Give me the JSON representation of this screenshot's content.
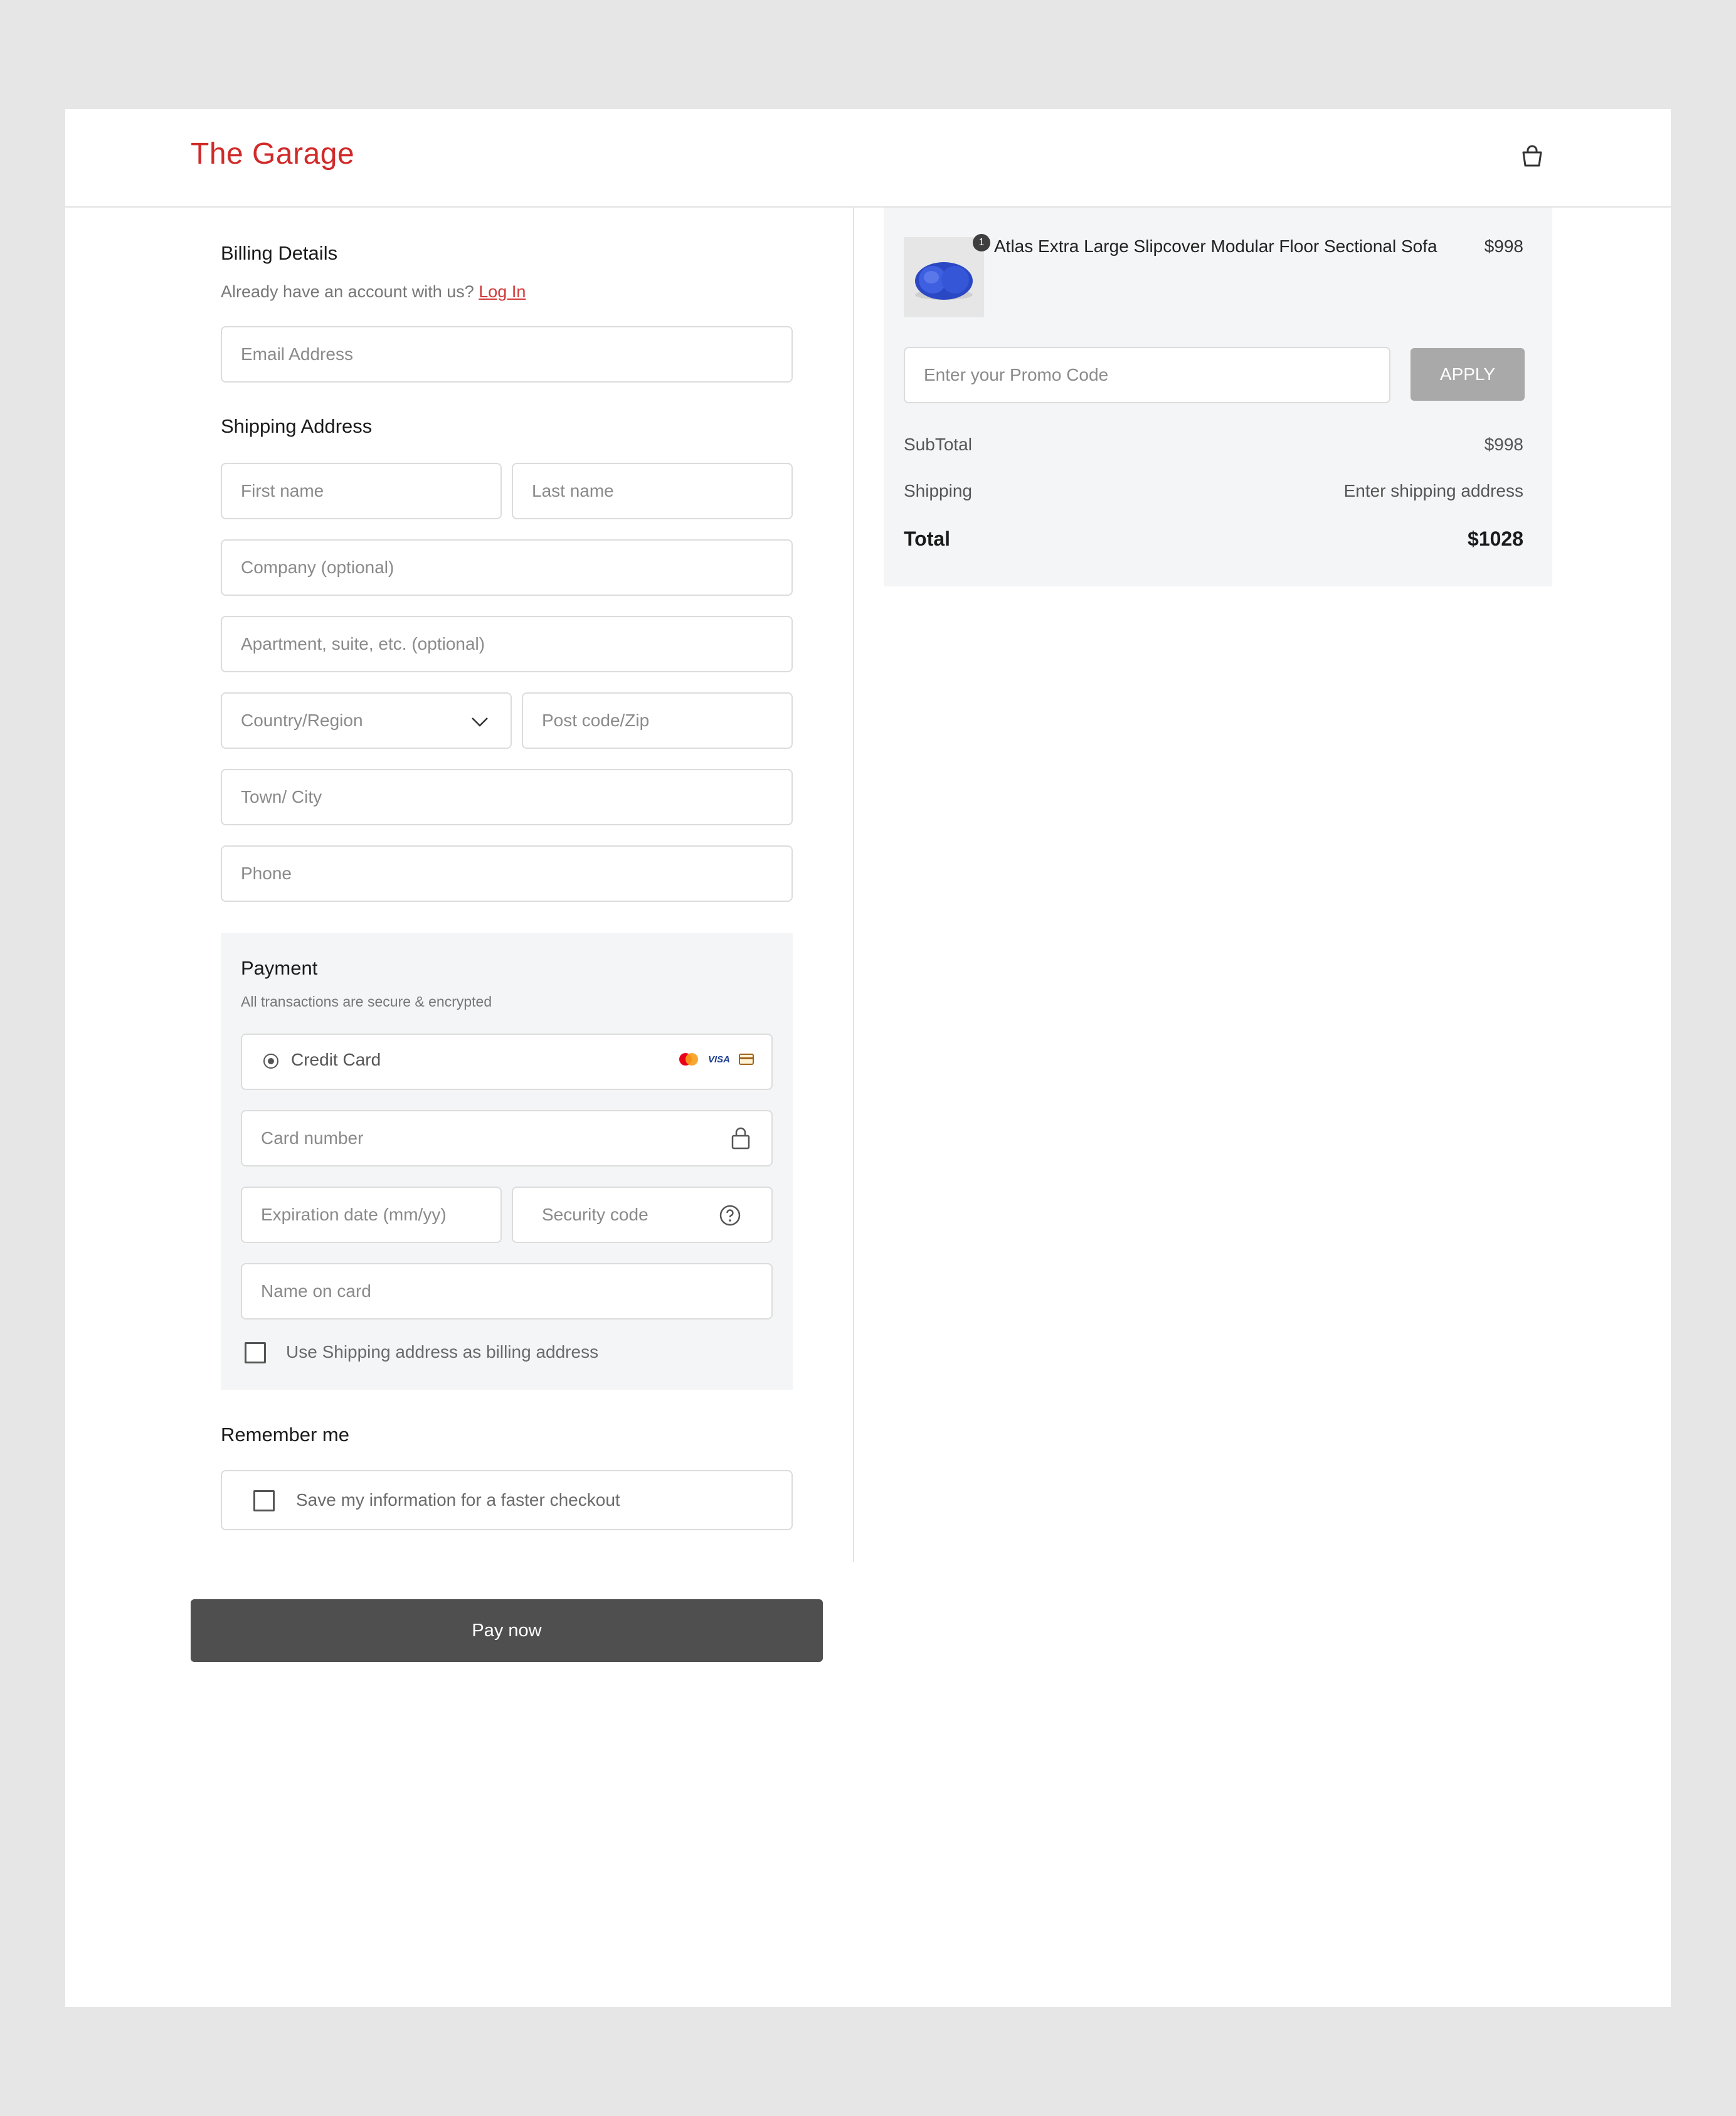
{
  "header": {
    "brand": "The Garage",
    "brand_color": "#d12a2a",
    "cart_icon": "shopping-bag-icon"
  },
  "billing": {
    "title": "Billing Details",
    "account_prompt": "Already have an account with us?",
    "login_link": "Log In",
    "email_placeholder": "Email Address"
  },
  "shipping": {
    "title": "Shipping Address",
    "first_name_placeholder": "First name",
    "last_name_placeholder": "Last name",
    "company_placeholder": "Company (optional)",
    "apartment_placeholder": "Apartment, suite, etc. (optional)",
    "country_placeholder": "Country/Region",
    "postcode_placeholder": "Post code/Zip",
    "city_placeholder": "Town/ City",
    "phone_placeholder": "Phone"
  },
  "payment": {
    "title": "Payment",
    "subtitle": "All transactions are secure & encrypted",
    "method_label": "Credit Card",
    "method_selected": true,
    "card_brands": [
      "mastercard-icon",
      "visa-icon",
      "generic-card-icon"
    ],
    "visa_text": "VISA",
    "card_number_placeholder": "Card number",
    "expiration_placeholder": "Expiration date (mm/yy)",
    "security_code_placeholder": "Security code",
    "name_on_card_placeholder": "Name on card",
    "billing_same_label": "Use Shipping address as billing address",
    "billing_same_checked": false
  },
  "remember": {
    "title": "Remember me",
    "save_label": "Save my information for a faster checkout",
    "save_checked": false
  },
  "pay_button": "Pay now",
  "summary": {
    "product_name": "Atlas Extra Large Slipcover Modular Floor Sectional Sofa",
    "product_price": "$998",
    "quantity": "1",
    "promo_placeholder": "Enter your Promo Code",
    "apply_label": "APPLY",
    "subtotal_label": "SubTotal",
    "subtotal_value": "$998",
    "shipping_label": "Shipping",
    "shipping_value": "Enter shipping address",
    "total_label": "Total",
    "total_value": "$1028"
  }
}
